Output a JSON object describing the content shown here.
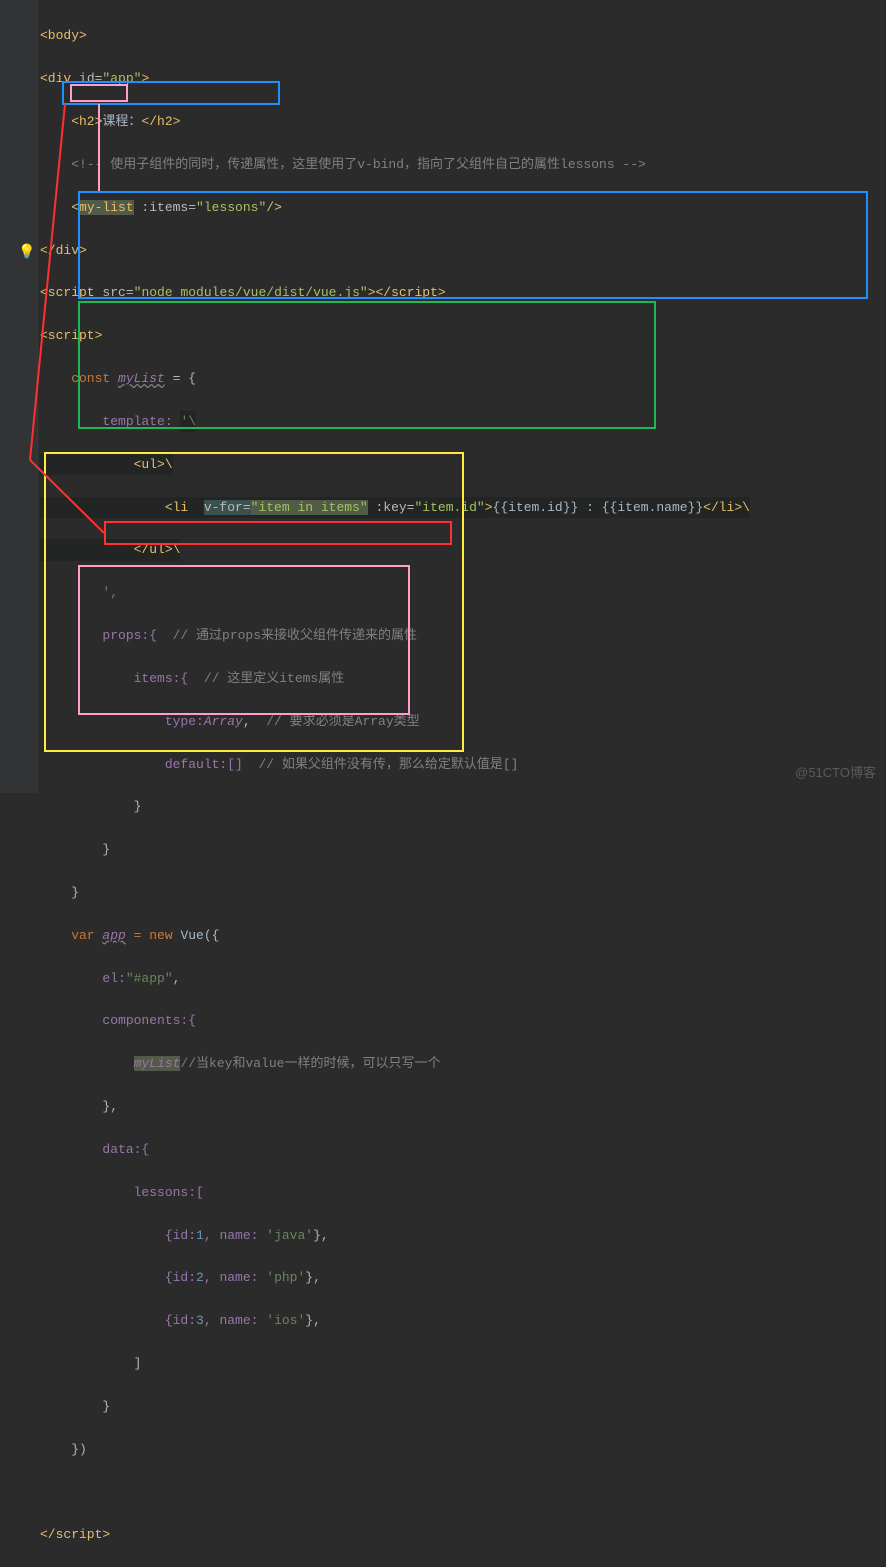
{
  "code": {
    "l1": "<body>",
    "l2a": "<div ",
    "l2b": "id=",
    "l2c": "\"app\"",
    "l2d": ">",
    "l3a": "    <h2>",
    "l3b": "课程：",
    "l3c": "</h2>",
    "l4": "    <!-- 使用子组件的同时，传递属性，这里使用了v-bind，指向了父组件自己的属性lessons -->",
    "l5a": "    <",
    "l5b": "my-list",
    "l5c": " :items=",
    "l5d": "\"lessons\"",
    "l5e": "/>",
    "l6": "</div>",
    "l7a": "<script ",
    "l7b": "src=",
    "l7c": "\"node_modules/vue/dist/vue.js\"",
    "l7d": "></script>",
    "l8": "<script>",
    "l9a": "    const ",
    "l9b": "myList",
    "l9c": " = {",
    "l10a": "        template: ",
    "l10b": "'\\",
    "l11": "            <ul>\\",
    "l12a": "                <li  ",
    "l12b": "v-for=",
    "l12c": "\"item in items\"",
    "l12d": " :key=",
    "l12e": "\"item.id\"",
    "l12f": ">",
    "l12g": "{{item.id}} : {{item.name}}",
    "l12h": "</li>\\",
    "l13": "            </ul>\\",
    "l14": "        ',",
    "l15a": "        props:{  ",
    "l15b": "// 通过props来接收父组件传递来的属性",
    "l16a": "            items:{  ",
    "l16b": "// 这里定义items属性",
    "l17a": "                type:",
    "l17b": "Array",
    "l17c": ",  ",
    "l17d": "// 要求必须是Array类型",
    "l18a": "                default:[]  ",
    "l18b": "// 如果父组件没有传，那么给定默认值是[]",
    "l19": "            }",
    "l20": "        }",
    "l21": "    }",
    "l22a": "    var ",
    "l22b": "app",
    "l22c": " = new ",
    "l22d": "Vue",
    "l22e": "({",
    "l23a": "        el:",
    "l23b": "\"#app\"",
    "l23c": ",",
    "l24": "        components:{",
    "l25a": "            ",
    "l25b": "myList",
    "l25c": "//当key和value一样的时候，可以只写一个",
    "l26": "        },",
    "l27": "        data:{",
    "l28": "            lessons:[",
    "l29a": "                {id:",
    "l29b": "1",
    "l29c": ", name: ",
    "l29d": "'java'",
    "l29e": "},",
    "l30a": "                {id:",
    "l30b": "2",
    "l30c": ", name: ",
    "l30d": "'php'",
    "l30e": "},",
    "l31a": "                {id:",
    "l31b": "3",
    "l31c": ", name: ",
    "l31d": "'ios'",
    "l31e": "},",
    "l32": "            ]",
    "l33": "        }",
    "l34": "    })",
    "l35": "",
    "l36": "</script>"
  },
  "watermark": "@51CTO博客"
}
